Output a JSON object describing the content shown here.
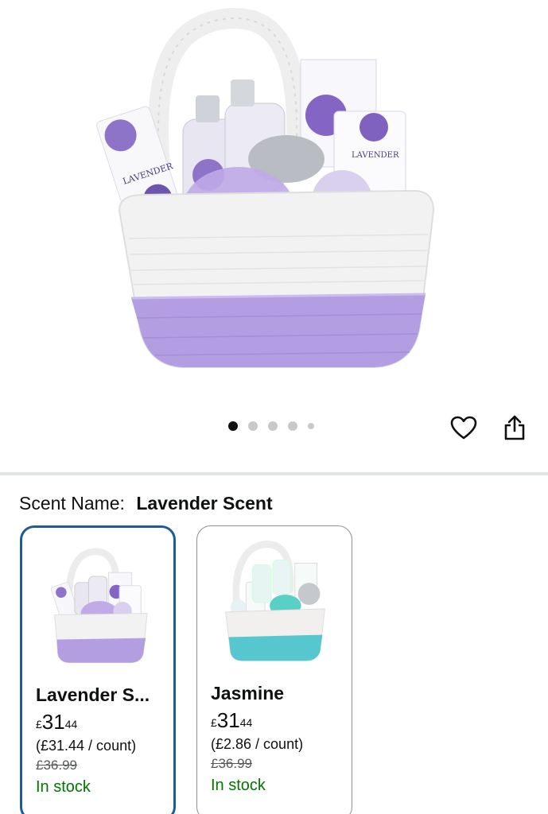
{
  "carousel": {
    "total": 5,
    "active_index": 0
  },
  "actions": {
    "wishlist_icon": "heart-icon",
    "share_icon": "share-icon"
  },
  "scent": {
    "label": "Scent Name:",
    "value": "Lavender Scent"
  },
  "options": [
    {
      "name": "Lavender S...",
      "price_currency": "£",
      "price_whole": "31",
      "price_fraction": "44",
      "unit_price": "(£31.44 / count)",
      "was_price": "£36.99",
      "stock": "In stock",
      "selected": true,
      "accent": "#b7a3e6"
    },
    {
      "name": "Jasmine",
      "price_currency": "£",
      "price_whole": "31",
      "price_fraction": "44",
      "unit_price": "(£2.86 / count)",
      "was_price": "£36.99",
      "stock": "In stock",
      "selected": false,
      "accent": "#56c6cf"
    }
  ],
  "colors": {
    "selected_border": "#1f5b96",
    "stock_green": "#007600",
    "lavender": "#b7a3e6",
    "aqua": "#56c6cf"
  }
}
